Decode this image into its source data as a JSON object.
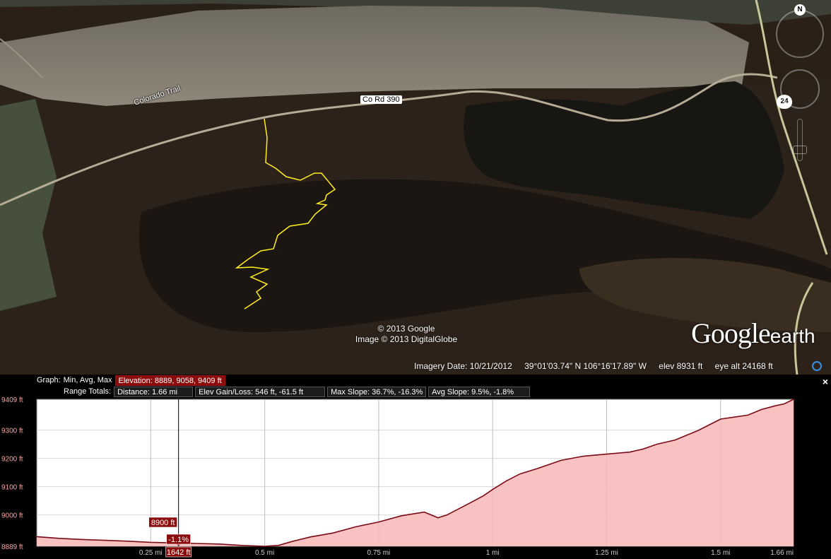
{
  "map": {
    "trail_label": "Colorado Trail",
    "road_label": "Co Rd 390",
    "highway_shield": "24",
    "north_label": "N",
    "copyright_lines": [
      "© 2013 Google",
      "Image © 2013 DigitalGlobe"
    ],
    "logo": {
      "google": "Google",
      "earth": "earth"
    }
  },
  "status": {
    "imagery_date": "Imagery Date: 10/21/2012",
    "coordinates": "39°01'03.74\" N  106°16'17.89\" W",
    "elevation": "elev  8931 ft",
    "eye_alt": "eye alt  24168 ft"
  },
  "panel": {
    "graph_label": "Graph:",
    "graph_options": "Min, Avg, Max",
    "elevation_stat": "Elevation: 8889, 9058, 9409 ft",
    "range_totals_label": "Range Totals:",
    "distance": "Distance: 1.66 mi",
    "elev_gain_loss": "Elev Gain/Loss: 546 ft, -61.5 ft",
    "max_slope": "Max Slope: 36.7%, -16.3%",
    "avg_slope": "Avg Slope: 9.5%, -1.8%",
    "close": "×"
  },
  "cursor": {
    "elevation": "8900 ft",
    "slope": "-1.1%",
    "distance": "1642 ft",
    "distance_mi": 0.311
  },
  "colors": {
    "profile_fill": "#f7b7b7",
    "profile_line": "#7a0a14",
    "trail": "#ffee22",
    "badge": "#8b0c0c"
  },
  "chart_data": {
    "type": "area",
    "xlim": [
      0,
      1.66
    ],
    "ylim": [
      8889,
      9409
    ],
    "y_ticks": [
      "9409 ft",
      "9300 ft",
      "9200 ft",
      "9100 ft",
      "9000 ft",
      "8889 ft"
    ],
    "y_tick_values": [
      9409,
      9300,
      9200,
      9100,
      9000,
      8889
    ],
    "x_ticks": [
      "0.25 mi",
      "0.5 mi",
      "0.75 mi",
      "1 mi",
      "1.25 mi",
      "1.5 mi",
      "1.66 mi"
    ],
    "x_tick_values": [
      0.25,
      0.5,
      0.75,
      1.0,
      1.25,
      1.5,
      1.66
    ],
    "x": [
      0,
      0.05,
      0.1,
      0.15,
      0.2,
      0.25,
      0.3,
      0.35,
      0.4,
      0.45,
      0.5,
      0.53,
      0.56,
      0.6,
      0.65,
      0.7,
      0.75,
      0.8,
      0.85,
      0.88,
      0.9,
      0.95,
      0.98,
      1.0,
      1.03,
      1.06,
      1.1,
      1.15,
      1.2,
      1.25,
      1.3,
      1.33,
      1.36,
      1.4,
      1.45,
      1.5,
      1.53,
      1.56,
      1.59,
      1.62,
      1.64,
      1.66
    ],
    "y": [
      8923,
      8917,
      8913,
      8910,
      8907,
      8903,
      8901,
      8899,
      8897,
      8892,
      8889,
      8892,
      8906,
      8922,
      8936,
      8958,
      8975,
      8997,
      9010,
      8990,
      9000,
      9042,
      9068,
      9090,
      9120,
      9145,
      9165,
      9193,
      9208,
      9215,
      9222,
      9233,
      9250,
      9265,
      9298,
      9339,
      9346,
      9353,
      9373,
      9386,
      9393,
      9409
    ]
  }
}
